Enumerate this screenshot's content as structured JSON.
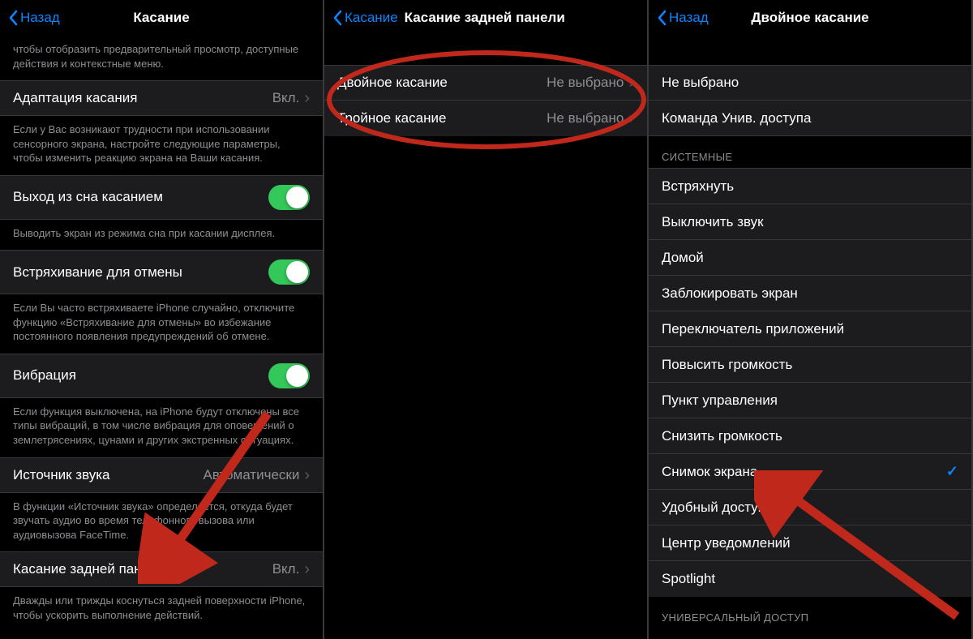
{
  "screen1": {
    "back": "Назад",
    "title": "Касание",
    "intro_footer": "чтобы отобразить предварительный просмотр, доступные действия и контекстные меню.",
    "row_adapt": {
      "label": "Адаптация касания",
      "value": "Вкл."
    },
    "footer_adapt": "Если у Вас возникают трудности при использовании сенсорного экрана, настройте следующие параметры, чтобы изменить реакцию экрана на Ваши касания.",
    "row_wake": {
      "label": "Выход из сна касанием"
    },
    "footer_wake": "Выводить экран из режима сна при касании дисплея.",
    "row_shake": {
      "label": "Встряхивание для отмены"
    },
    "footer_shake": "Если Вы часто встряхиваете iPhone случайно, отключите функцию «Встряхивание для отмены» во избежание постоянного появления предупреждений об отмене.",
    "row_vibe": {
      "label": "Вибрация"
    },
    "footer_vibe": "Если функция выключена, на iPhone будут отключены все типы вибраций, в том числе вибрация для оповещений о землетрясениях, цунами и других экстренных ситуациях.",
    "row_audio": {
      "label": "Источник звука",
      "value": "Автоматически"
    },
    "footer_audio": "В функции «Источник звука» определяется, откуда будет звучать аудио во время телефонного вызова или аудиовызова FaceTime.",
    "row_backtap": {
      "label": "Касание задней панели",
      "value": "Вкл."
    },
    "footer_backtap": "Дважды или трижды коснуться задней поверхности iPhone, чтобы ускорить выполнение действий."
  },
  "screen2": {
    "back": "Касание",
    "title": "Касание задней панели",
    "row_double": {
      "label": "Двойное касание",
      "value": "Не выбрано"
    },
    "row_triple": {
      "label": "Тройное касание",
      "value": "Не выбрано"
    }
  },
  "screen3": {
    "back": "Назад",
    "title": "Двойное касание",
    "row_none": "Не выбрано",
    "row_shortcut": "Команда Унив. доступа",
    "section_system": "СИСТЕМНЫЕ",
    "system_items": [
      "Встряхнуть",
      "Выключить звук",
      "Домой",
      "Заблокировать экран",
      "Переключатель приложений",
      "Повысить громкость",
      "Пункт управления",
      "Снизить громкость",
      "Снимок экрана",
      "Удобный доступ",
      "Центр уведомлений",
      "Spotlight"
    ],
    "selected_index": 8,
    "section_access": "УНИВЕРСАЛЬНЫЙ ДОСТУП"
  }
}
